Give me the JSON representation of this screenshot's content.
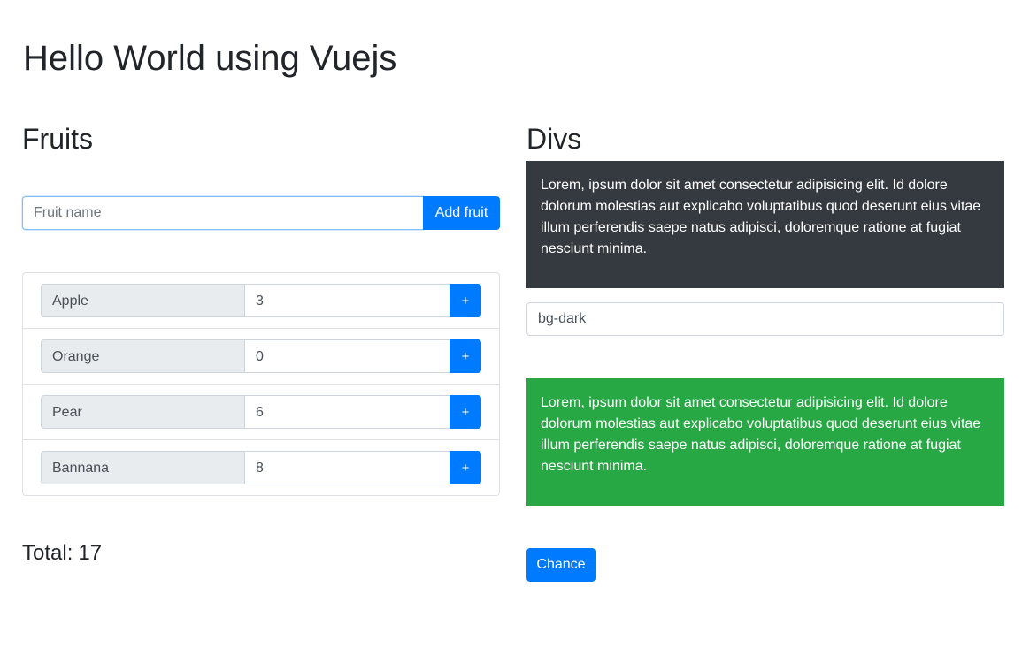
{
  "page": {
    "title": "Hello World using Vuejs"
  },
  "fruits": {
    "heading": "Fruits",
    "input_placeholder": "Fruit name",
    "input_value": "",
    "add_button_label": "Add fruit",
    "items": [
      {
        "name": "Apple",
        "quantity": "3",
        "button_label": "+"
      },
      {
        "name": "Orange",
        "quantity": "0",
        "button_label": "+"
      },
      {
        "name": "Pear",
        "quantity": "6",
        "button_label": "+"
      },
      {
        "name": "Bannana",
        "quantity": "8",
        "button_label": "+"
      }
    ],
    "total_label": "Total:",
    "total_value": "17"
  },
  "divs": {
    "heading": "Divs",
    "box1_text": "Lorem, ipsum dolor sit amet consectetur adipisicing elit. Id dolore dolorum molestias aut explicabo voluptatibus quod deserunt eius vitae illum perferendis saepe natus adipisci, doloremque ratione at fugiat nesciunt minima.",
    "class_input_value": "bg-dark",
    "box2_text": "Lorem, ipsum dolor sit amet consectetur adipisicing elit. Id dolore dolorum molestias aut explicabo voluptatibus quod deserunt eius vitae illum perferendis saepe natus adipisci, doloremque ratione at fugiat nesciunt minima.",
    "change_button_label": "Chance"
  },
  "colors": {
    "primary": "#007bff",
    "dark": "#343a40",
    "success": "#28a745",
    "input_addon_bg": "#e9ecef"
  }
}
